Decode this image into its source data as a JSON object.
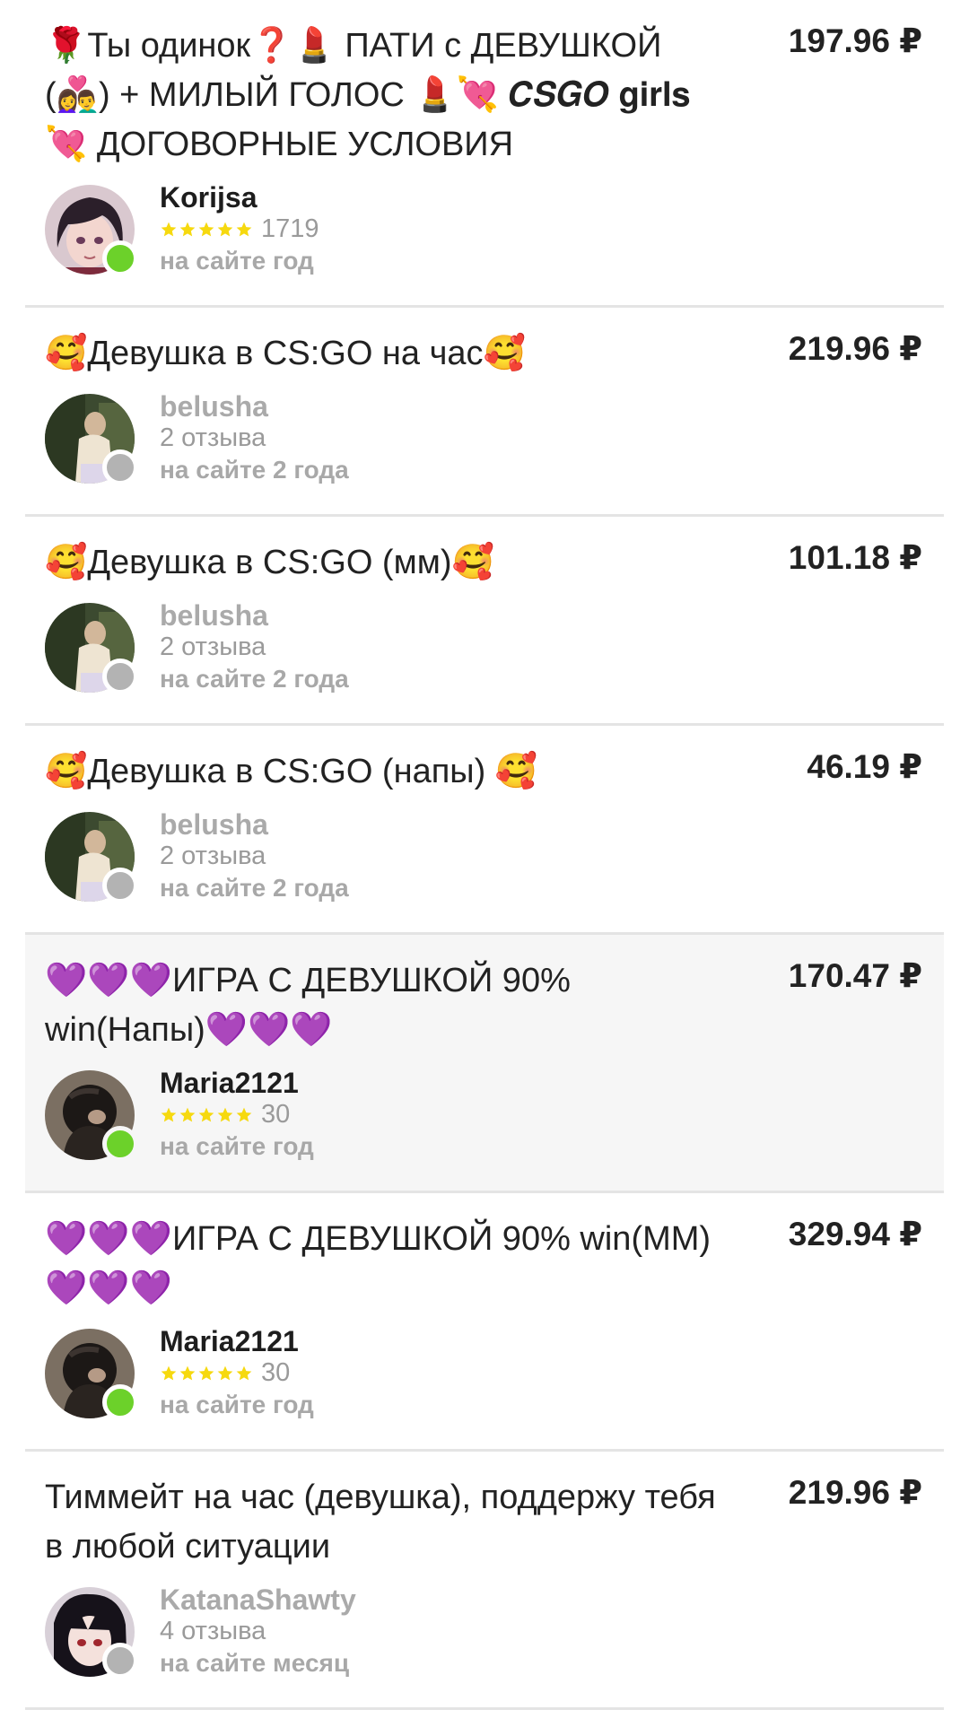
{
  "colors": {
    "online": "#6cd12a",
    "offline": "#b3b3b3",
    "star": "#f6d90f",
    "divider": "#e4e4e4",
    "highlight_bg": "#f6f6f6"
  },
  "offers": [
    {
      "title": "🌹Ты одинок❓💄 ПАТИ с ДЕВУШКОЙ (👩‍❤️‍👨) + МИЛЫЙ ГОЛОС 💄💘 𝑪𝑺𝑮𝑶 𝐠𝐢𝐫𝐥𝐬 💘 ДОГОВОРНЫЕ УСЛОВИЯ",
      "price": "197.96 ₽",
      "seller": "Korijsa",
      "rating_stars": 5,
      "stat": "1719",
      "since": "на сайте год",
      "online": true,
      "avatar": "anime-girl-avatar"
    },
    {
      "title": "🥰Девушка в CS:GO на час🥰",
      "price": "219.96 ₽",
      "seller": "belusha",
      "rating_stars": 0,
      "stat": "2 отзыва",
      "since": "на сайте 2 года",
      "online": false,
      "avatar": "photo-avatar"
    },
    {
      "title": "🥰Девушка в CS:GO (мм)🥰",
      "price": "101.18 ₽",
      "seller": "belusha",
      "rating_stars": 0,
      "stat": "2 отзыва",
      "since": "на сайте 2 года",
      "online": false,
      "avatar": "photo-avatar"
    },
    {
      "title": "🥰Девушка в CS:GO (напы) 🥰",
      "price": "46.19 ₽",
      "seller": "belusha",
      "rating_stars": 0,
      "stat": "2 отзыва",
      "since": "на сайте 2 года",
      "online": false,
      "avatar": "photo-avatar"
    },
    {
      "title": "💜💜💜ИГРА С ДЕВУШКОЙ 90% win(Напы)💜💜💜",
      "price": "170.47 ₽",
      "seller": "Maria2121",
      "rating_stars": 5,
      "stat": "30",
      "since": "на сайте год",
      "online": true,
      "highlighted": true,
      "avatar": "dark-photo-avatar"
    },
    {
      "title": "💜💜💜ИГРА С ДЕВУШКОЙ 90% win(ММ) 💜💜💜",
      "price": "329.94 ₽",
      "seller": "Maria2121",
      "rating_stars": 5,
      "stat": "30",
      "since": "на сайте год",
      "online": true,
      "avatar": "dark-photo-avatar"
    },
    {
      "title": "Тиммейт на час (девушка), поддержу тебя в любой ситуации",
      "price": "219.96 ₽",
      "seller": "KatanaShawty",
      "rating_stars": 0,
      "stat": "4 отзыва",
      "since": "на сайте месяц",
      "online": false,
      "avatar": "anime-dark-hair-avatar"
    }
  ]
}
